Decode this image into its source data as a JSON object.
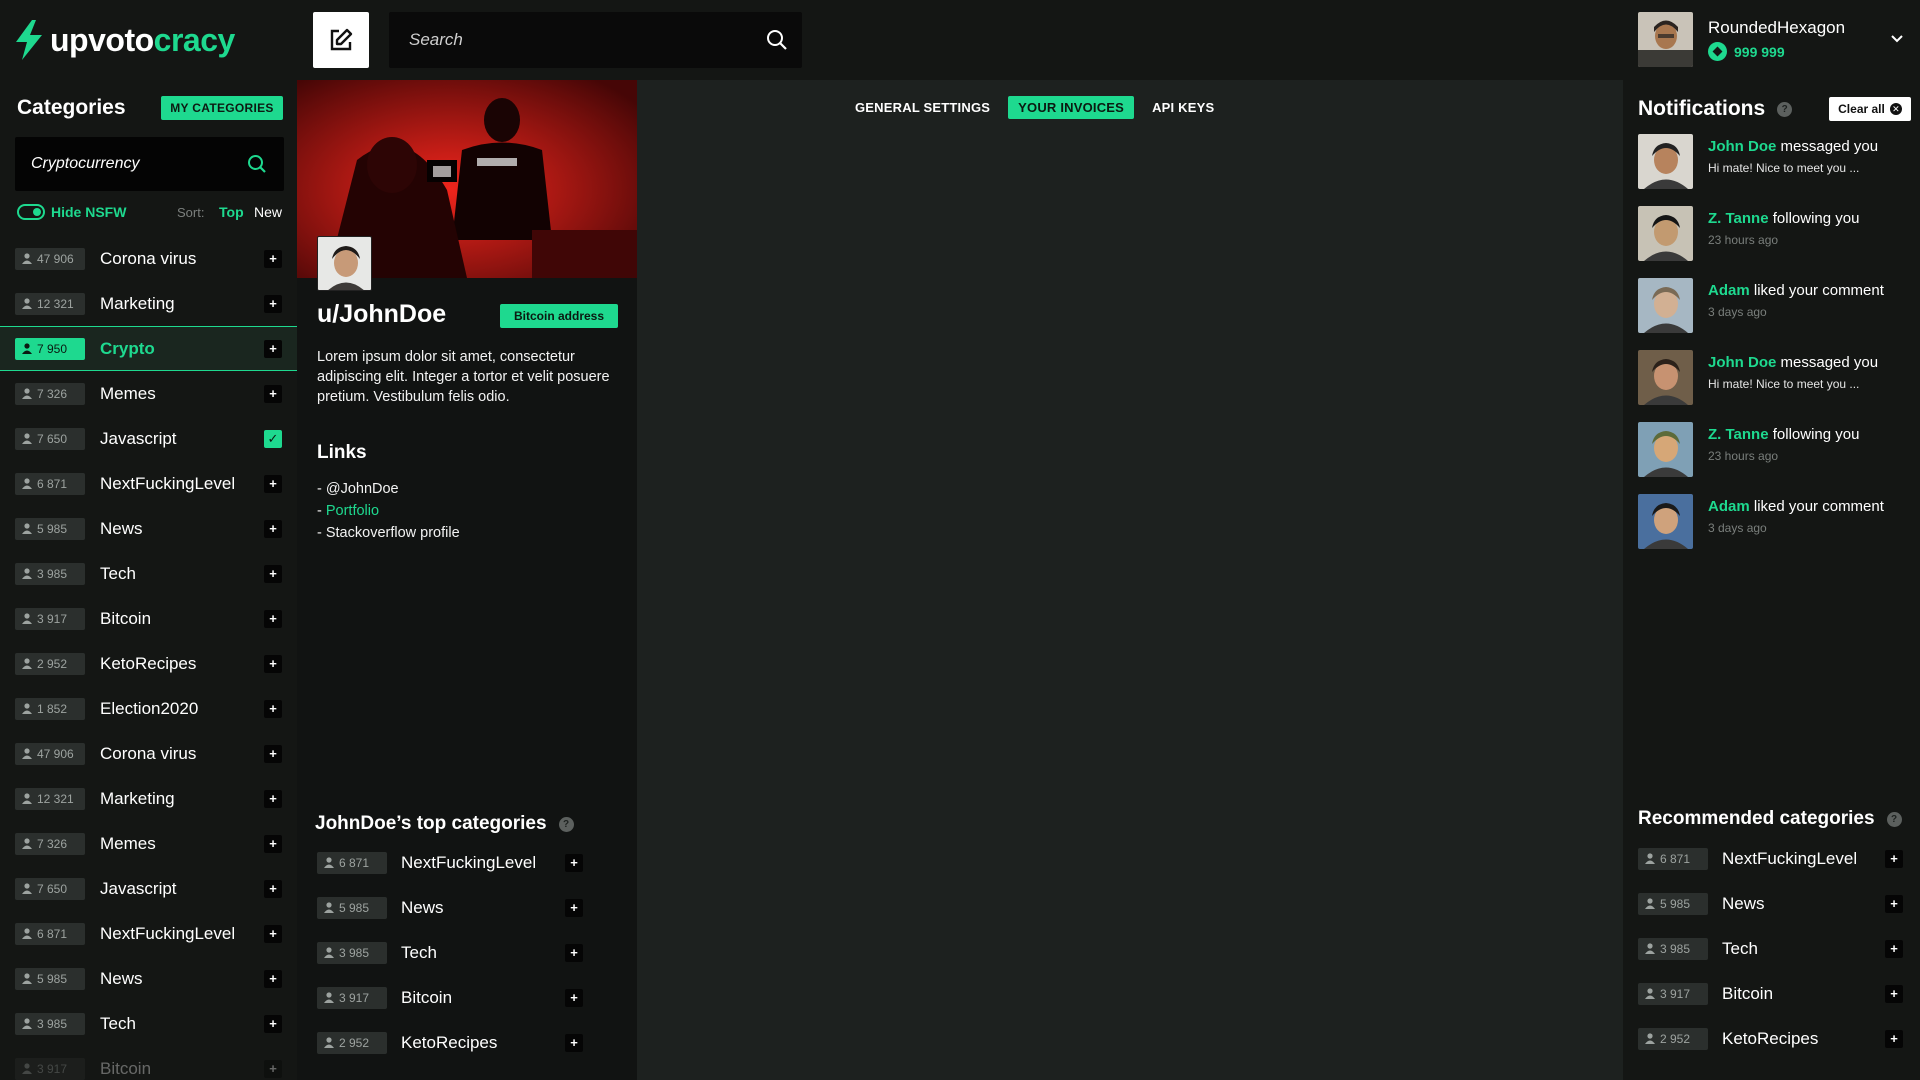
{
  "app": {
    "logo_text_1": "upvoto",
    "logo_text_2": "cracy",
    "accent_color": "#1ed98f",
    "search_placeholder": "Search"
  },
  "user": {
    "name": "RoundedHexagon",
    "balance": "999 999"
  },
  "left_sidebar": {
    "title": "Categories",
    "my_categories_label": "MY CATEGORIES",
    "search_value": "Cryptocurrency",
    "hide_nsfw_label": "Hide NSFW",
    "sort_label": "Sort:",
    "sort_top": "Top",
    "sort_new": "New",
    "categories": [
      {
        "count": "47 906",
        "name": "Corona virus",
        "state": "add"
      },
      {
        "count": "12 321",
        "name": "Marketing",
        "state": "add"
      },
      {
        "count": "7 950",
        "name": "Crypto",
        "state": "add",
        "active": true
      },
      {
        "count": "7 326",
        "name": "Memes",
        "state": "add"
      },
      {
        "count": "7 650",
        "name": "Javascript",
        "state": "checked"
      },
      {
        "count": "6 871",
        "name": "NextFuckingLevel",
        "state": "add"
      },
      {
        "count": "5 985",
        "name": "News",
        "state": "add"
      },
      {
        "count": "3 985",
        "name": "Tech",
        "state": "add"
      },
      {
        "count": "3 917",
        "name": "Bitcoin",
        "state": "add"
      },
      {
        "count": "2 952",
        "name": "KetoRecipes",
        "state": "add"
      },
      {
        "count": "1 852",
        "name": "Election2020",
        "state": "add"
      },
      {
        "count": "47 906",
        "name": "Corona virus",
        "state": "add"
      },
      {
        "count": "12 321",
        "name": "Marketing",
        "state": "add"
      },
      {
        "count": "7 326",
        "name": "Memes",
        "state": "add"
      },
      {
        "count": "7 650",
        "name": "Javascript",
        "state": "add"
      },
      {
        "count": "6 871",
        "name": "NextFuckingLevel",
        "state": "add"
      },
      {
        "count": "5 985",
        "name": "News",
        "state": "add"
      },
      {
        "count": "3 985",
        "name": "Tech",
        "state": "add"
      },
      {
        "count": "3 917",
        "name": "Bitcoin",
        "state": "add",
        "faded": true
      }
    ]
  },
  "profile": {
    "username": "u/JohnDoe",
    "bitcoin_button": "Bitcoin address",
    "bio": "Lorem ipsum dolor sit amet, consectetur adipiscing elit. Integer a tortor et velit posuere pretium. Vestibulum felis odio.",
    "links_title": "Links",
    "links": [
      {
        "prefix": "- ",
        "text": "@JohnDoe",
        "highlight": false
      },
      {
        "prefix": "- ",
        "text": "Portfolio",
        "highlight": true
      },
      {
        "prefix": "- ",
        "text": "Stackoverflow profile",
        "highlight": false
      }
    ],
    "top_categories_title": "JohnDoe’s top categories",
    "top_categories": [
      {
        "count": "6 871",
        "name": "NextFuckingLevel"
      },
      {
        "count": "5 985",
        "name": "News"
      },
      {
        "count": "3 985",
        "name": "Tech"
      },
      {
        "count": "3 917",
        "name": "Bitcoin"
      },
      {
        "count": "2 952",
        "name": "KetoRecipes"
      }
    ]
  },
  "tabs": [
    {
      "label": "GENERAL SETTINGS",
      "active": false
    },
    {
      "label": "YOUR INVOICES",
      "active": true
    },
    {
      "label": "API KEYS",
      "active": false
    }
  ],
  "notifications": {
    "title": "Notifications",
    "clear_label": "Clear all",
    "items": [
      {
        "who": "John Doe",
        "action": "messaged you",
        "sub": "Hi mate! Nice to meet you ...",
        "is_time": false
      },
      {
        "who": "Z. Tanne",
        "action": "following you",
        "sub": "23 hours ago",
        "is_time": true
      },
      {
        "who": "Adam",
        "action": "liked your comment",
        "sub": "3 days ago",
        "is_time": true
      },
      {
        "who": "John Doe",
        "action": "messaged you",
        "sub": "Hi mate! Nice to meet you ...",
        "is_time": false
      },
      {
        "who": "Z. Tanne",
        "action": "following you",
        "sub": "23 hours ago",
        "is_time": true
      },
      {
        "who": "Adam",
        "action": "liked your comment",
        "sub": "3 days ago",
        "is_time": true
      }
    ]
  },
  "recommended": {
    "title": "Recommended categories",
    "items": [
      {
        "count": "6 871",
        "name": "NextFuckingLevel"
      },
      {
        "count": "5 985",
        "name": "News"
      },
      {
        "count": "3 985",
        "name": "Tech"
      },
      {
        "count": "3 917",
        "name": "Bitcoin"
      },
      {
        "count": "2 952",
        "name": "KetoRecipes"
      }
    ]
  }
}
